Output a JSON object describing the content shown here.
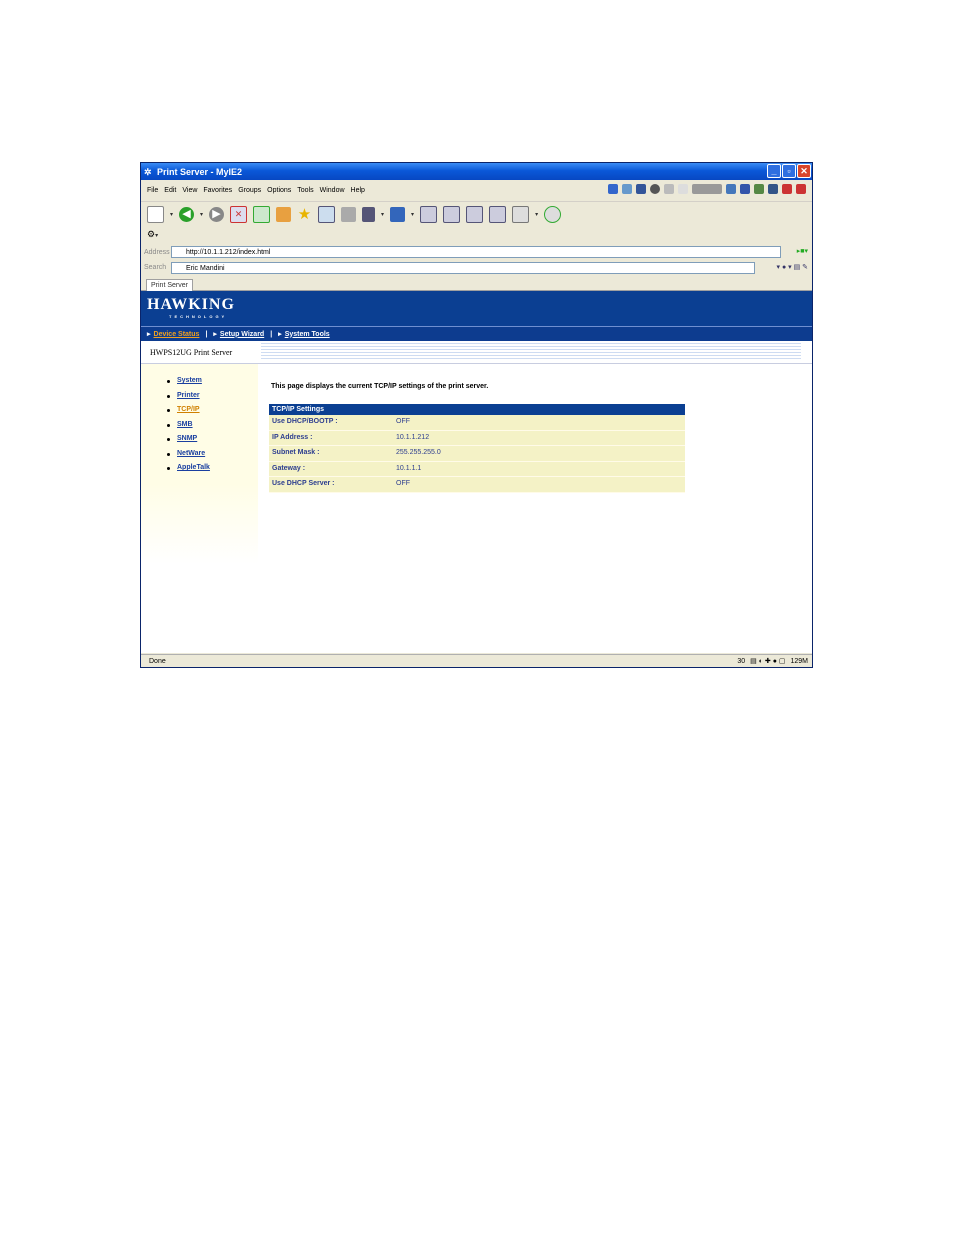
{
  "window": {
    "title": "Print Server - MyIE2"
  },
  "menu": [
    "File",
    "Edit",
    "View",
    "Favorites",
    "Groups",
    "Options",
    "Tools",
    "Window",
    "Help"
  ],
  "address": {
    "label": "Address",
    "url": "http://10.1.1.212/index.html"
  },
  "search": {
    "label": "Search",
    "value": "Eric Mandini"
  },
  "tab": {
    "label": "Print Server"
  },
  "brand": {
    "name": "HAWKING",
    "sub": "TECHNOLOGY"
  },
  "nav": {
    "device_status": "Device Status",
    "setup_wizard": "Setup Wizard",
    "system_tools": "System Tools"
  },
  "page": {
    "section_title": "HWPS12UG Print Server",
    "description": "This page displays the current TCP/IP settings of the print server."
  },
  "sidebar": {
    "items": [
      {
        "label": "System"
      },
      {
        "label": "Printer"
      },
      {
        "label": "TCP/IP"
      },
      {
        "label": "SMB"
      },
      {
        "label": "SNMP"
      },
      {
        "label": "NetWare"
      },
      {
        "label": "AppleTalk"
      }
    ]
  },
  "settings": {
    "header": "TCP/IP Settings",
    "rows": [
      {
        "key": "Use DHCP/BOOTP :",
        "value": "OFF"
      },
      {
        "key": "IP Address :",
        "value": "10.1.1.212"
      },
      {
        "key": "Subnet Mask :",
        "value": "255.255.255.0"
      },
      {
        "key": "Gateway :",
        "value": "10.1.1.1"
      },
      {
        "key": "Use DHCP Server :",
        "value": "OFF"
      }
    ]
  },
  "status": {
    "text": "Done",
    "count": "30",
    "memory": "129M"
  }
}
